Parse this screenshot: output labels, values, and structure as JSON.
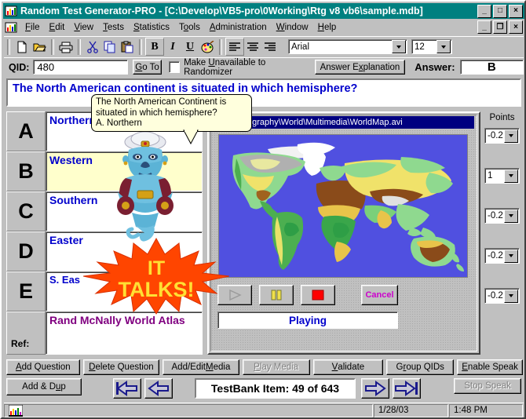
{
  "window": {
    "title": "Random Test Generator-PRO  -  [C:\\Develop\\VB5-pro\\0Working\\Rtg v8 vb6\\sample.mdb]",
    "app_icon": "chart-icon",
    "minimize": "_",
    "maximize": "□",
    "close": "×",
    "mdi_minimize": "_",
    "mdi_restore": "❐",
    "mdi_close": "×"
  },
  "menu": {
    "items": [
      {
        "label": "File",
        "accel": "F"
      },
      {
        "label": "Edit",
        "accel": "E"
      },
      {
        "label": "View",
        "accel": "V"
      },
      {
        "label": "Tests",
        "accel": "T"
      },
      {
        "label": "Statistics",
        "accel": "S"
      },
      {
        "label": "Tools",
        "accel": "o"
      },
      {
        "label": "Administration",
        "accel": "A"
      },
      {
        "label": "Window",
        "accel": "W"
      },
      {
        "label": "Help",
        "accel": "H"
      }
    ]
  },
  "toolbar": {
    "icons": [
      "new-document-icon",
      "open-folder-icon",
      "print-icon",
      "cut-scissors-icon",
      "copy-icon",
      "paste-icon",
      "bold-icon",
      "italic-icon",
      "underline-icon",
      "color-palette-icon",
      "align-left-icon",
      "align-center-icon",
      "align-right-icon"
    ],
    "bold_label": "B",
    "italic_label": "I",
    "underline_label": "U",
    "font_name": "Arial",
    "font_size": "12"
  },
  "qid_row": {
    "qid_label": "QID:",
    "qid_value": "480",
    "go_to_label": "Go To",
    "unavailable_checkbox_label": "Make Unavailable to Randomizer",
    "unavailable_checked": false,
    "answer_explanation_label": "Answer Explanation",
    "answer_label": "Answer:",
    "answer_value": "B"
  },
  "question": {
    "text": "The North American continent is situated in which hemisphere?"
  },
  "balloon": {
    "line1": "The North American Continent is",
    "line2": "situated in which hemisphere?",
    "line3": "A.   Northern"
  },
  "choices": {
    "points_header": "Points",
    "rows": [
      {
        "letter": "A",
        "text": "Northern",
        "points": "-0.25",
        "selected": false
      },
      {
        "letter": "B",
        "text": "Western",
        "points": "1",
        "selected": true
      },
      {
        "letter": "C",
        "text": "Southern",
        "points": "-0.25",
        "selected": false
      },
      {
        "letter": "D",
        "text": "Easter",
        "points": "-0.25",
        "selected": false
      },
      {
        "letter": "E",
        "text": "S. Eas",
        "points": "-0.25",
        "selected": false
      }
    ],
    "ref_label": "Ref:",
    "ref_text": "Rand McNally World Atlas"
  },
  "media": {
    "title": "anks\\Geography\\World\\Multimedia\\WorldMap.avi",
    "image_name": "world-map-image",
    "play_icon": "play-icon",
    "pause_icon": "pause-icon",
    "stop_icon": "stop-icon",
    "cancel_label": "Cancel",
    "status": "Playing",
    "genie_icon": "genie-icon",
    "starburst_text_line1": "IT",
    "starburst_text_line2": "TALKS!"
  },
  "bottom_buttons": {
    "row1": [
      {
        "label": "Add Question",
        "accel": "A",
        "disabled": false
      },
      {
        "label": "Delete Question",
        "accel": "D",
        "disabled": false
      },
      {
        "label": "Add/Edit Media",
        "accel": "M",
        "disabled": false
      },
      {
        "label": "Play Media",
        "accel": "P",
        "disabled": true
      },
      {
        "label": "Validate",
        "accel": "V",
        "disabled": false
      },
      {
        "label": "Group QIDs",
        "accel": "r",
        "disabled": false
      },
      {
        "label": "Enable Speak",
        "accel": "E",
        "disabled": false
      }
    ],
    "add_dup_label": "Add & Dup",
    "stop_speak_label": "Stop Speak",
    "stop_speak_disabled": true,
    "item_counter": "TestBank Item: 49 of 643",
    "nav_first_icon": "first-arrow-icon",
    "nav_prev_icon": "prev-arrow-icon",
    "nav_next_icon": "next-arrow-icon",
    "nav_last_icon": "last-arrow-icon"
  },
  "status_bar": {
    "icon": "chart-icon",
    "date": "1/28/03",
    "time": "1:48 PM"
  },
  "colors": {
    "titlebar": "#008080",
    "question_text": "#0000cc",
    "ref_text": "#800080",
    "selected_row": "#ffffcc",
    "media_titlebar": "#000080",
    "ocean": "#5050e0",
    "starburst": "#ff4500",
    "starburst_text": "#ffe033"
  }
}
